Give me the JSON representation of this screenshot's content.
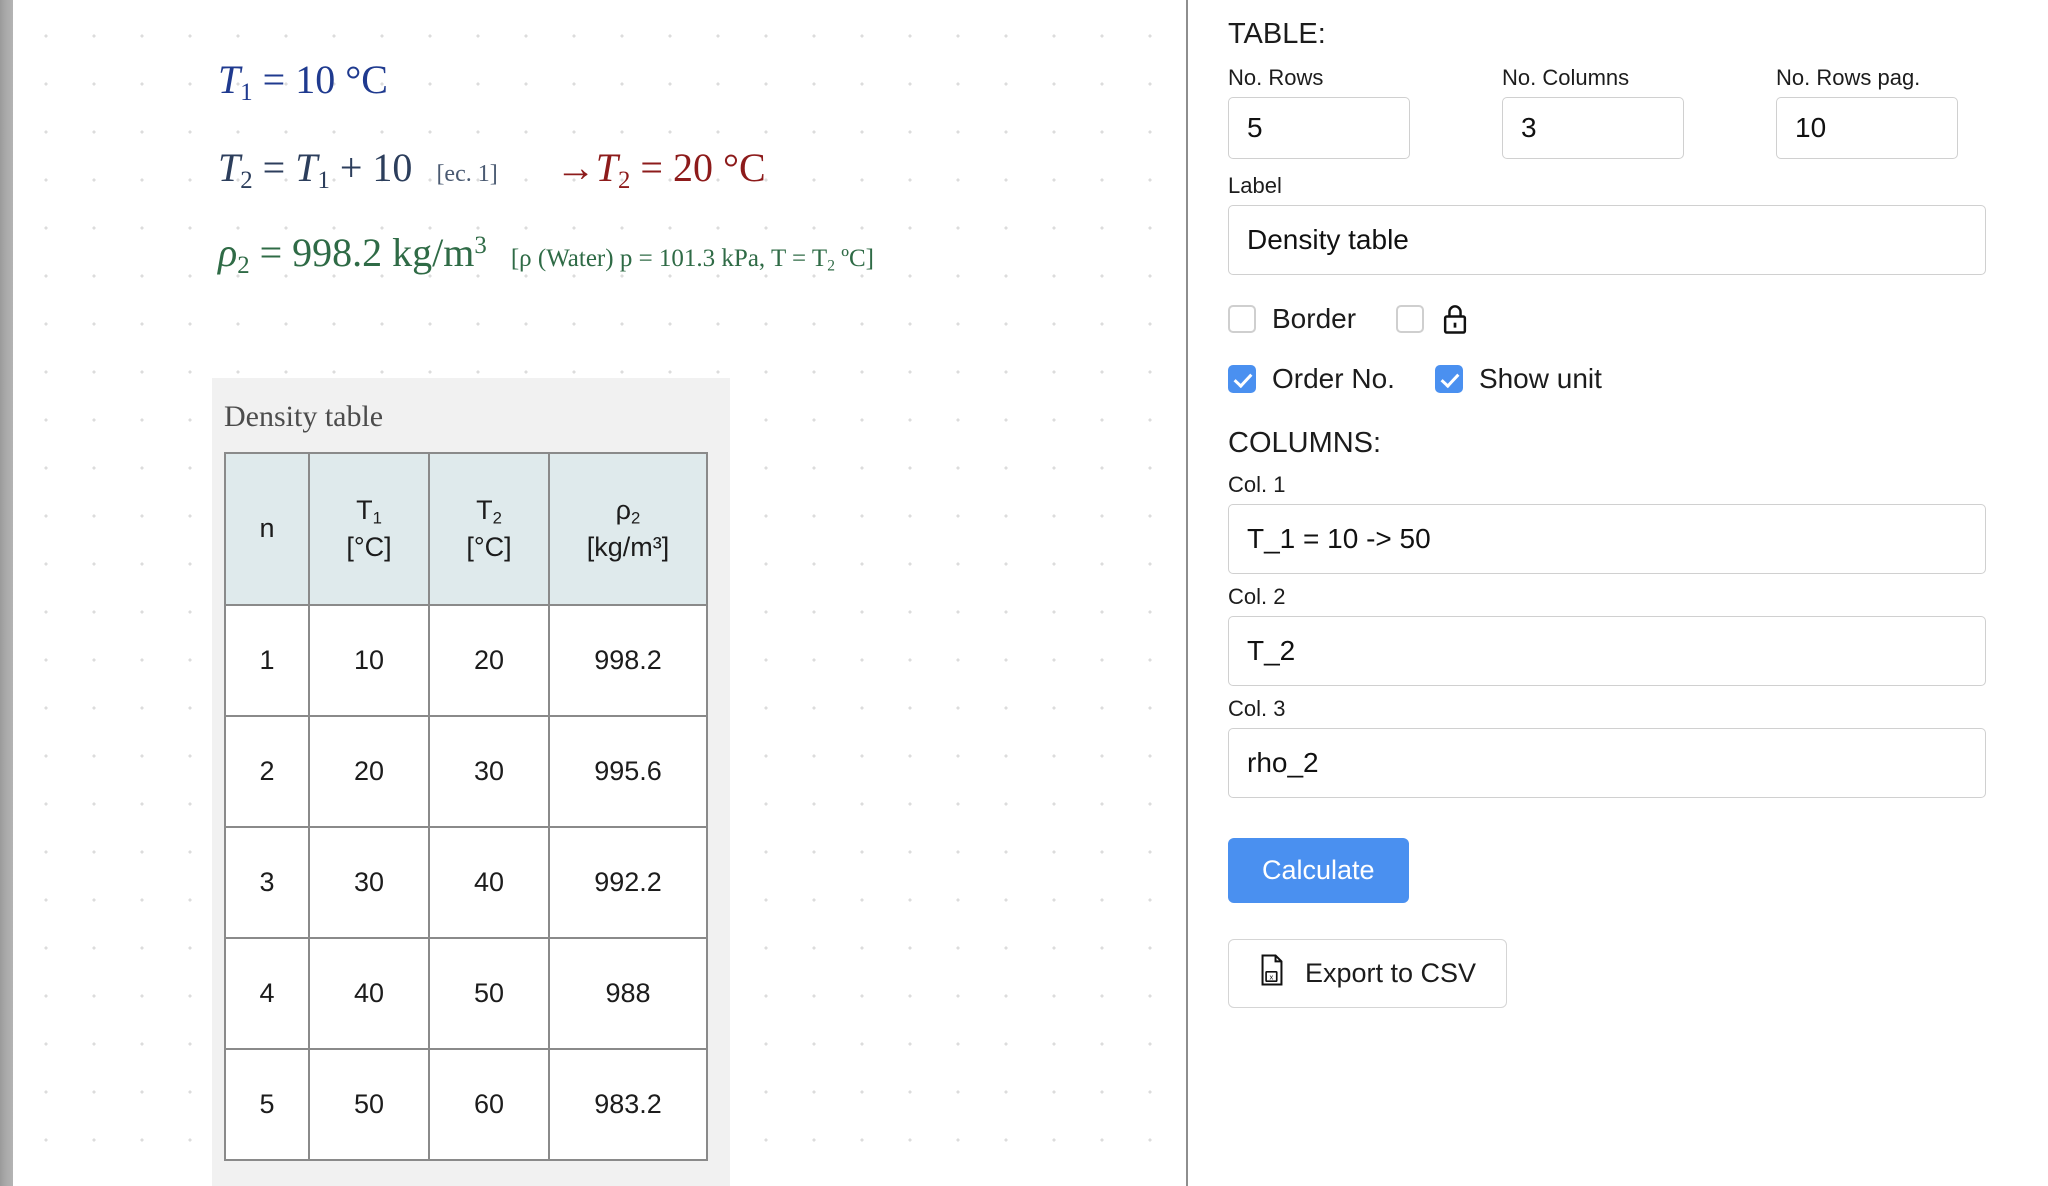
{
  "canvas": {
    "equations": [
      {
        "id": "eq-t1",
        "var": "T",
        "sub": "1",
        "rhs": "10 °C",
        "color": "#1f3a8f"
      },
      {
        "id": "eq-t2",
        "var": "T",
        "sub": "2",
        "rhs": "T₁ + 10",
        "note": "[ec. 1]",
        "result_var": "T",
        "result_sub": "2",
        "result_value": "20 °C",
        "color": "#2c3e5c",
        "result_color": "#8d1b1b"
      },
      {
        "id": "eq-rho2",
        "var": "ρ",
        "sub": "2",
        "rhs": "998.2 kg/m³",
        "note": "[ρ (Water) p = 101.3 kPa, T = T₂ ºC]",
        "color": "#2f6b46"
      }
    ],
    "eq1_lhs": "T",
    "eq1_sub": "1",
    "eq1_eq": "=",
    "eq1_value": "10",
    "eq1_unit": "°C",
    "eq2_lhs": "T",
    "eq2_sub": "2",
    "eq2_eq": "=",
    "eq2_rhs_var": "T",
    "eq2_rhs_sub": "1",
    "eq2_plus": "+ 10",
    "eq2_note": "[ec. 1]",
    "eq2_arrow": "→",
    "eq2_res_var": "T",
    "eq2_res_sub": "2",
    "eq2_res_eq": "=",
    "eq2_res_value": "20",
    "eq2_res_unit": "°C",
    "eq3_lhs": "ρ",
    "eq3_sub": "2",
    "eq3_eq": "=",
    "eq3_value": "998.2",
    "eq3_unit_base": "kg/m",
    "eq3_unit_sup": "3",
    "eq3_note": "[ρ (Water) p = 101.3 kPa, T = T",
    "eq3_note_sub": "2",
    "eq3_note_tail": " ºC]"
  },
  "table_card": {
    "title": "Density table",
    "columns": [
      {
        "symbol": "n",
        "unit": ""
      },
      {
        "symbol": "T₁",
        "sym_base": "T",
        "sym_sub": "1",
        "unit": "[°C]"
      },
      {
        "symbol": "T₂",
        "sym_base": "T",
        "sym_sub": "2",
        "unit": "[°C]"
      },
      {
        "symbol": "ρ₂",
        "sym_base": "ρ",
        "sym_sub": "2",
        "unit": "[kg/m³]"
      }
    ],
    "rows": [
      [
        "1",
        "10",
        "20",
        "998.2"
      ],
      [
        "2",
        "20",
        "30",
        "995.6"
      ],
      [
        "3",
        "30",
        "40",
        "992.2"
      ],
      [
        "4",
        "40",
        "50",
        "988"
      ],
      [
        "5",
        "50",
        "60",
        "983.2"
      ]
    ]
  },
  "panel": {
    "table_section_title": "TABLE:",
    "no_rows_label": "No. Rows",
    "no_rows_value": "5",
    "no_columns_label": "No. Columns",
    "no_columns_value": "3",
    "no_rows_pag_label": "No. Rows pag.",
    "no_rows_pag_value": "10",
    "label_label": "Label",
    "label_value": "Density table",
    "border_checkbox_label": "Border",
    "border_checked": false,
    "lock_checked": false,
    "order_no_label": "Order No.",
    "order_no_checked": true,
    "show_unit_label": "Show unit",
    "show_unit_checked": true,
    "columns_section_title": "COLUMNS:",
    "col1_label": "Col. 1",
    "col1_value": "T_1 = 10 -> 50",
    "col2_label": "Col. 2",
    "col2_value": "T_2",
    "col3_label": "Col. 3",
    "col3_value": "rho_2",
    "calculate_button": "Calculate",
    "export_button": "Export to CSV",
    "accent_color": "#4a90f0"
  }
}
